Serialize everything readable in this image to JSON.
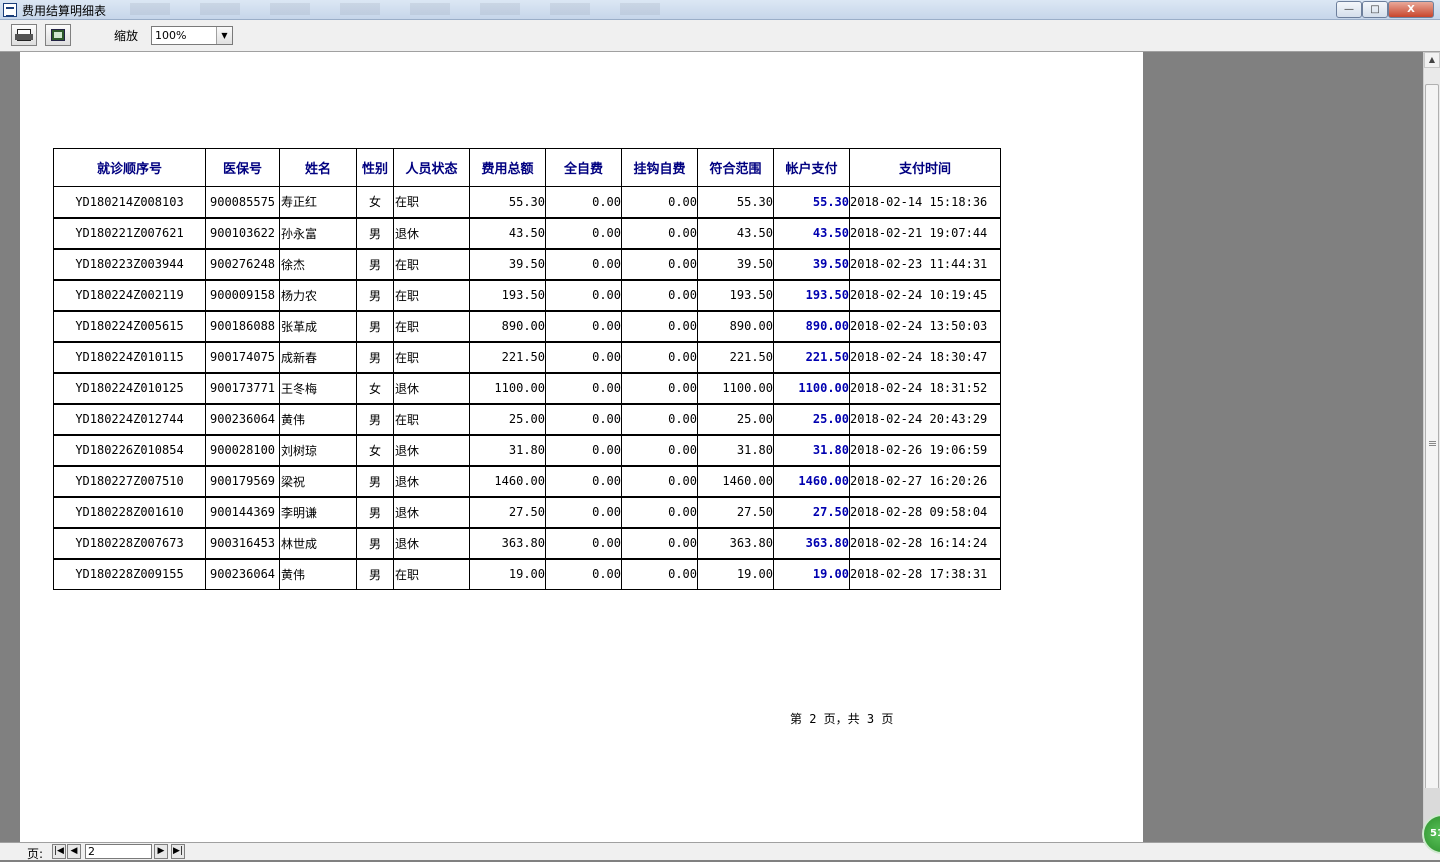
{
  "window": {
    "title": "费用结算明细表",
    "controls": {
      "minimize": "—",
      "maximize": "□",
      "close": "X"
    }
  },
  "toolbar": {
    "print_icon": "printer-icon",
    "export_icon": "export-icon",
    "zoom_label": "缩放",
    "zoom_value": "100%"
  },
  "report": {
    "columns": [
      "就诊顺序号",
      "医保号",
      "姓名",
      "性别",
      "人员状态",
      "费用总额",
      "全自费",
      "挂钩自费",
      "符合范围",
      "帐户支付",
      "支付时间"
    ],
    "rows": [
      [
        "YD180214Z008103",
        "900085575",
        "寿正红",
        "女",
        "在职",
        "55.30",
        "0.00",
        "0.00",
        "55.30",
        "55.30",
        "2018-02-14 15:18:36"
      ],
      [
        "YD180221Z007621",
        "900103622",
        "孙永富",
        "男",
        "退休",
        "43.50",
        "0.00",
        "0.00",
        "43.50",
        "43.50",
        "2018-02-21 19:07:44"
      ],
      [
        "YD180223Z003944",
        "900276248",
        "徐杰",
        "男",
        "在职",
        "39.50",
        "0.00",
        "0.00",
        "39.50",
        "39.50",
        "2018-02-23 11:44:31"
      ],
      [
        "YD180224Z002119",
        "900009158",
        "杨力农",
        "男",
        "在职",
        "193.50",
        "0.00",
        "0.00",
        "193.50",
        "193.50",
        "2018-02-24 10:19:45"
      ],
      [
        "YD180224Z005615",
        "900186088",
        "张革成",
        "男",
        "在职",
        "890.00",
        "0.00",
        "0.00",
        "890.00",
        "890.00",
        "2018-02-24 13:50:03"
      ],
      [
        "YD180224Z010115",
        "900174075",
        "成新春",
        "男",
        "在职",
        "221.50",
        "0.00",
        "0.00",
        "221.50",
        "221.50",
        "2018-02-24 18:30:47"
      ],
      [
        "YD180224Z010125",
        "900173771",
        "王冬梅",
        "女",
        "退休",
        "1100.00",
        "0.00",
        "0.00",
        "1100.00",
        "1100.00",
        "2018-02-24 18:31:52"
      ],
      [
        "YD180224Z012744",
        "900236064",
        "黄伟",
        "男",
        "在职",
        "25.00",
        "0.00",
        "0.00",
        "25.00",
        "25.00",
        "2018-02-24 20:43:29"
      ],
      [
        "YD180226Z010854",
        "900028100",
        "刘树琼",
        "女",
        "退休",
        "31.80",
        "0.00",
        "0.00",
        "31.80",
        "31.80",
        "2018-02-26 19:06:59"
      ],
      [
        "YD180227Z007510",
        "900179569",
        "梁祝",
        "男",
        "退休",
        "1460.00",
        "0.00",
        "0.00",
        "1460.00",
        "1460.00",
        "2018-02-27 16:20:26"
      ],
      [
        "YD180228Z001610",
        "900144369",
        "李明谦",
        "男",
        "退休",
        "27.50",
        "0.00",
        "0.00",
        "27.50",
        "27.50",
        "2018-02-28 09:58:04"
      ],
      [
        "YD180228Z007673",
        "900316453",
        "林世成",
        "男",
        "退休",
        "363.80",
        "0.00",
        "0.00",
        "363.80",
        "363.80",
        "2018-02-28 16:14:24"
      ],
      [
        "YD180228Z009155",
        "900236064",
        "黄伟",
        "男",
        "在职",
        "19.00",
        "0.00",
        "0.00",
        "19.00",
        "19.00",
        "2018-02-28 17:38:31"
      ]
    ],
    "footer": "第 2 页，共 3 页"
  },
  "pager": {
    "label": "页:",
    "current_page": "2",
    "first_icon": "first-page-icon",
    "prev_icon": "prev-page-icon",
    "next_icon": "next-page-icon",
    "last_icon": "last-page-icon"
  },
  "badge": {
    "text": "51"
  },
  "colors": {
    "header_text": "#000080",
    "account_pay": "#0000b0",
    "viewer_bg": "#808080"
  }
}
